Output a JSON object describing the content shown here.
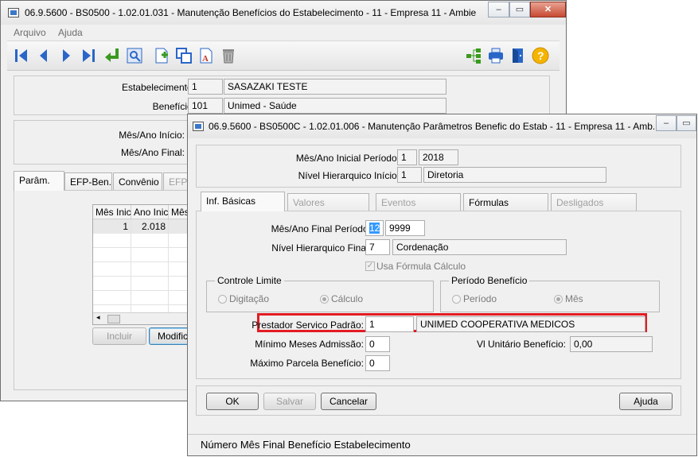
{
  "main_window": {
    "title": "06.9.5600 - BS0500 - 1.02.01.031 - Manutenção Benefícios do Estabelecimento - 11 - Empresa 11 - Ambie",
    "menu": [
      "Arquivo",
      "Ajuda"
    ],
    "fields": {
      "estabelecimento_label": "Estabelecimento:",
      "estabelecimento_code": "1",
      "estabelecimento_name": "SASAZAKI TESTE",
      "beneficio_label": "Benefício:",
      "beneficio_code": "101",
      "beneficio_name": "Unimed - Saúde",
      "mes_ano_inicio_label": "Mês/Ano Início:",
      "mes_ano_final_label": "Mês/Ano Final:"
    },
    "tabs": [
      "Parâm.",
      "EFP-Ben.",
      "Convênio",
      "EFP-"
    ],
    "grid": {
      "columns": [
        "Mês Inic",
        "Ano Inic",
        "Mês"
      ],
      "rows": [
        [
          "1",
          "2.018",
          ""
        ]
      ]
    },
    "buttons": {
      "incluir": "Incluir",
      "modificar": "Modifica"
    }
  },
  "dialog": {
    "title": "06.9.5600 - BS0500C - 1.02.01.006 - Manutenção Parâmetros Benefic do Estab - 11 - Empresa 11 - Amb...",
    "header": {
      "mes_ano_inicial_label": "Mês/Ano Inicial Período:",
      "mes_inicial": "1",
      "ano_inicial": "2018",
      "nivel_inicio_label": "Nível Hierarquico Início:",
      "nivel_inicio_code": "1",
      "nivel_inicio_name": "Diretoria"
    },
    "tabs": [
      {
        "label": "Inf. Básicas",
        "state": "active"
      },
      {
        "label": "Valores",
        "state": "disabled"
      },
      {
        "label": "Eventos",
        "state": "disabled"
      },
      {
        "label": "Fórmulas",
        "state": "enabled"
      },
      {
        "label": "Desligados",
        "state": "disabled"
      }
    ],
    "form": {
      "mes_ano_final_label": "Mês/Ano Final Período:",
      "mes_final": "12",
      "ano_final": "9999",
      "nivel_final_label": "Nível Hierarquico Final:",
      "nivel_final_code": "7",
      "nivel_final_name": "Cordenação",
      "usa_formula_label": "Usa Fórmula Cálculo",
      "controle_limite_title": "Controle Limite",
      "digitacao_label": "Digitação",
      "calculo_label": "Cálculo",
      "periodo_beneficio_title": "Período Benefício",
      "periodo_label": "Período",
      "mes_label": "Mês",
      "prestador_label": "Prestador Servico Padrão:",
      "prestador_code": "1",
      "prestador_name": "UNIMED COOPERATIVA MEDICOS",
      "minimo_meses_label": "Mínimo Meses Admissão:",
      "minimo_meses_value": "0",
      "vl_unitario_label": "Vl Unitário Benefício:",
      "vl_unitario_value": "0,00",
      "maximo_parcela_label": "Máximo Parcela Benefício:",
      "maximo_parcela_value": "0"
    },
    "buttons": {
      "ok": "OK",
      "salvar": "Salvar",
      "cancelar": "Cancelar",
      "ajuda": "Ajuda"
    },
    "status": "Número Mês Final Benefício Estabelecimento"
  },
  "colors": {
    "highlight": "#e31b23",
    "selection": "#3399ff",
    "toolbar_blue": "#2a66c8"
  }
}
